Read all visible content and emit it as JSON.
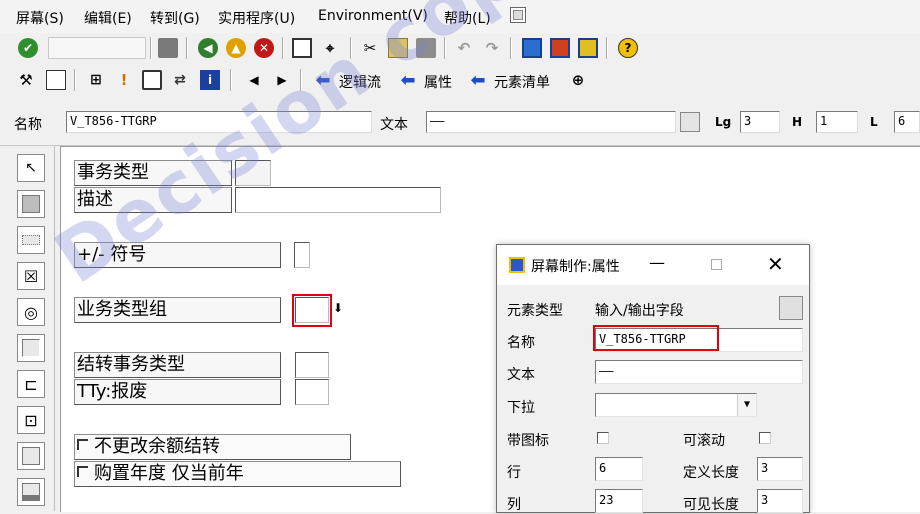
{
  "menubar": {
    "items": [
      "屏幕(S)",
      "编辑(E)",
      "转到(G)",
      "实用程序(U)",
      "Environment(V)",
      "帮助(L)"
    ]
  },
  "toolbar2": {
    "logic_flow": "逻辑流",
    "attributes": "属性",
    "element_list": "元素清单"
  },
  "namerow": {
    "name_label": "名称",
    "name_value": "V_T856-TTGRP",
    "text_label": "文本",
    "text_value": "——",
    "lg_label": "Lg",
    "lg_value": "3",
    "h_label": "H",
    "h_value": "1",
    "l_label": "L",
    "l_value": "6"
  },
  "canvas": {
    "txn_type_label": "事务类型",
    "desc_label": "描述",
    "sign_label": "+/- 符号",
    "biz_group_label": "业务类型组",
    "transfer_label": "结转事务类型",
    "scrap_label": "TTy:报废",
    "chk_no_change": "不更改余额结转",
    "chk_acq_year": "购置年度 仅当前年"
  },
  "dialog": {
    "title": "屏幕制作:属性",
    "elem_type_label": "元素类型",
    "elem_type_value": "输入/输出字段",
    "name_label": "名称",
    "name_value": "V_T856-TTGRP",
    "text_label": "文本",
    "text_value": "——",
    "dropdown_label": "下拉",
    "with_icon_label": "带图标",
    "scrollable_label": "可滚动",
    "row_label": "行",
    "row_value": "6",
    "def_len_label": "定义长度",
    "def_len_value": "3",
    "col_label": "列",
    "col_value": "23",
    "vis_len_label": "可见长度",
    "vis_len_value": "3"
  },
  "watermark": "Decision copyright",
  "colors": {
    "highlight": "#e00010",
    "watermark": "#7882d2",
    "arrow_blue": "#1f4fbf"
  }
}
